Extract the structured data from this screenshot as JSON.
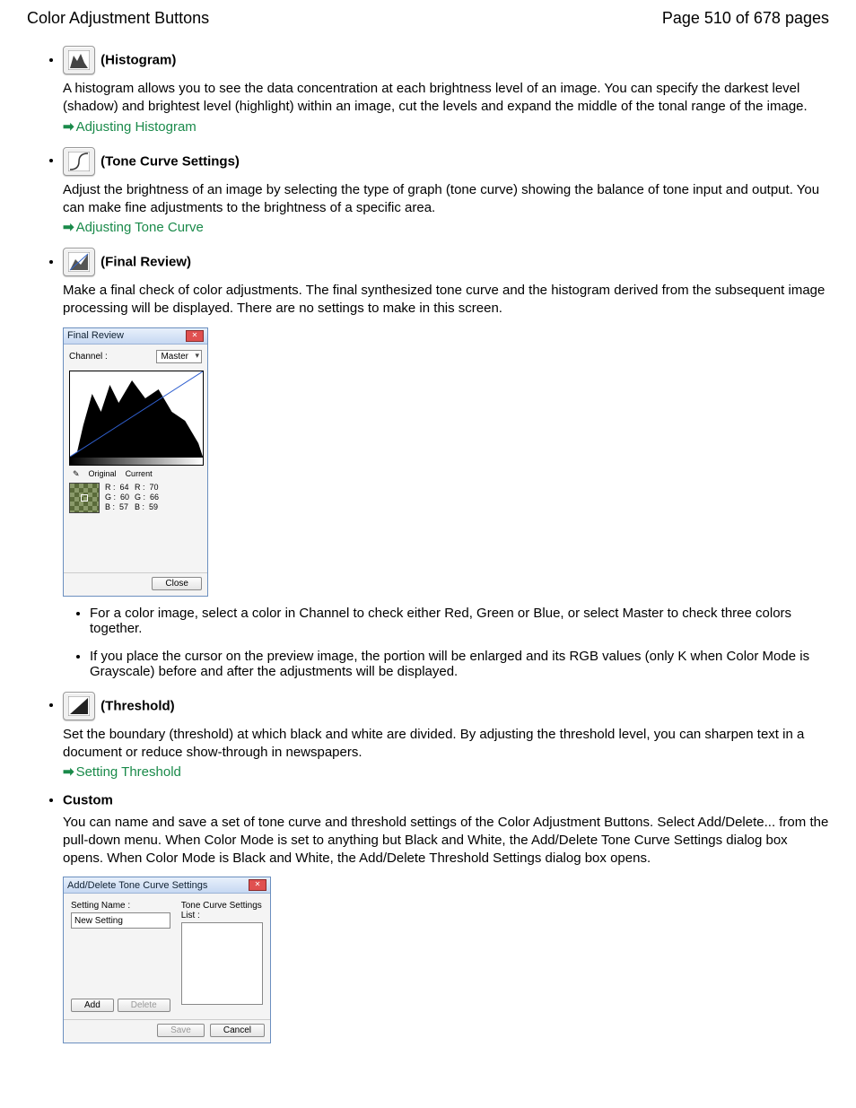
{
  "header": {
    "title": "Color Adjustment Buttons",
    "page": "Page 510 of 678 pages"
  },
  "items": {
    "histogram": {
      "name": "(Histogram)",
      "desc": "A histogram allows you to see the data concentration at each brightness level of an image. You can specify the darkest level (shadow) and brightest level (highlight) within an image, cut the levels and expand the middle of the tonal range of the image.",
      "link": "Adjusting Histogram"
    },
    "tonecurve": {
      "name": "(Tone Curve Settings)",
      "desc": "Adjust the brightness of an image by selecting the type of graph (tone curve) showing the balance of tone input and output. You can make fine adjustments to the brightness of a specific area.",
      "link": "Adjusting Tone Curve"
    },
    "final": {
      "name": "(Final Review)",
      "desc": "Make a final check of color adjustments. The final synthesized tone curve and the histogram derived from the subsequent image processing will be displayed. There are no settings to make in this screen.",
      "dialog": {
        "title": "Final Review",
        "channel_label": "Channel :",
        "channel_value": "Master",
        "original_label": "Original",
        "current_label": "Current",
        "rgb_orig": {
          "R": "64",
          "G": "60",
          "B": "57"
        },
        "rgb_curr": {
          "R": "70",
          "G": "66",
          "B": "59"
        },
        "close": "Close"
      },
      "sub1": "For a color image, select a color in Channel to check either Red, Green or Blue, or select Master to check three colors together.",
      "sub2": "If you place the cursor on the preview image, the portion will be enlarged and its RGB values (only K when Color Mode is Grayscale) before and after the adjustments will be displayed."
    },
    "threshold": {
      "name": "(Threshold)",
      "desc": "Set the boundary (threshold) at which black and white are divided. By adjusting the threshold level, you can sharpen text in a document or reduce show-through in newspapers.",
      "link": "Setting Threshold"
    },
    "custom": {
      "name": "Custom",
      "desc": "You can name and save a set of tone curve and threshold settings of the Color Adjustment Buttons. Select Add/Delete... from the pull-down menu. When Color Mode is set to anything but Black and White, the Add/Delete Tone Curve Settings dialog box opens. When Color Mode is Black and White, the Add/Delete Threshold Settings dialog box opens.",
      "dialog": {
        "title": "Add/Delete Tone Curve Settings",
        "setting_name_label": "Setting Name :",
        "setting_name_value": "New Setting",
        "list_label": "Tone Curve Settings List :",
        "add": "Add",
        "delete": "Delete",
        "save": "Save",
        "cancel": "Cancel"
      }
    }
  }
}
